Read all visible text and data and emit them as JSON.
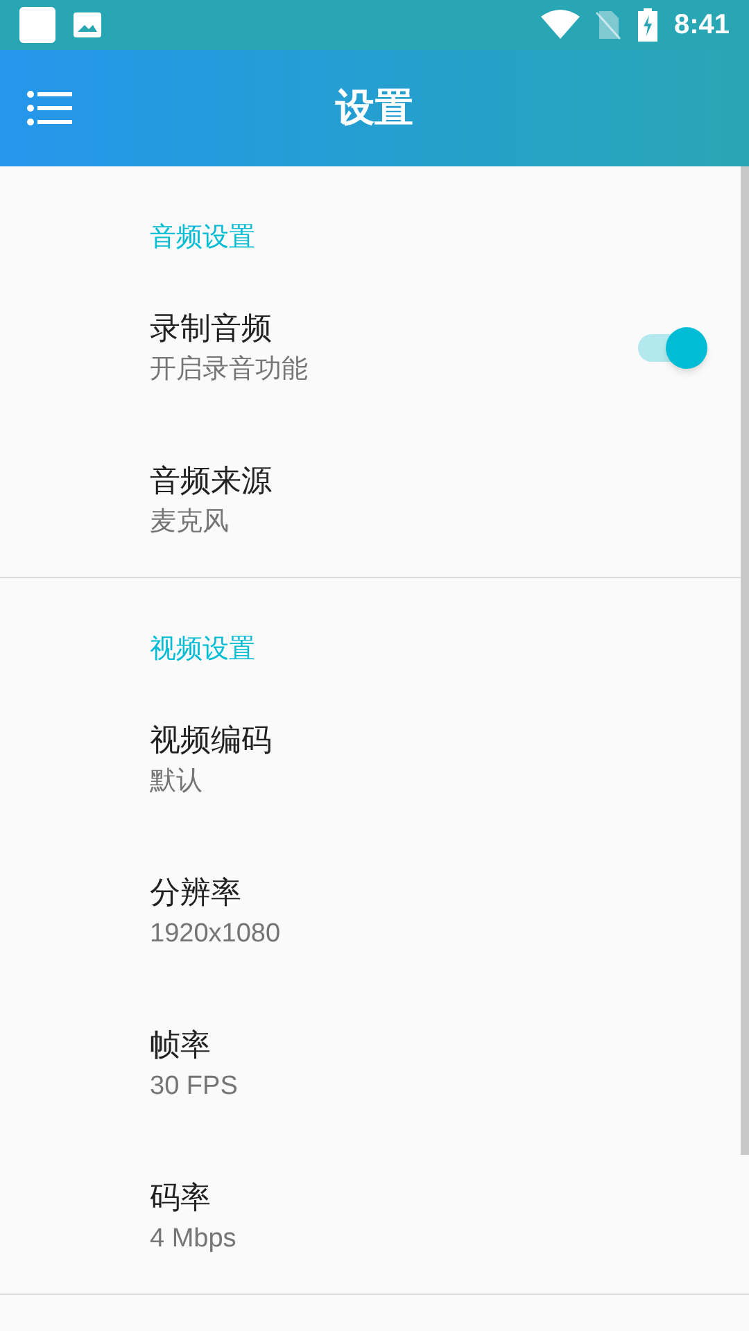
{
  "status_bar": {
    "time": "8:41"
  },
  "app_bar": {
    "title": "设置"
  },
  "sections": [
    {
      "title": "音频设置",
      "items": [
        {
          "kind": "switch",
          "title": "录制音频",
          "summary": "开启录音功能",
          "on": true
        },
        {
          "kind": "plain",
          "title": "音频来源",
          "summary": "麦克风"
        }
      ]
    },
    {
      "title": "视频设置",
      "items": [
        {
          "kind": "plain",
          "title": "视频编码",
          "summary": "默认"
        },
        {
          "kind": "plain",
          "title": "分辨率",
          "summary": "1920x1080"
        },
        {
          "kind": "plain",
          "title": "帧率",
          "summary": "30 FPS"
        },
        {
          "kind": "plain",
          "title": "码率",
          "summary": "4 Mbps"
        }
      ]
    }
  ]
}
